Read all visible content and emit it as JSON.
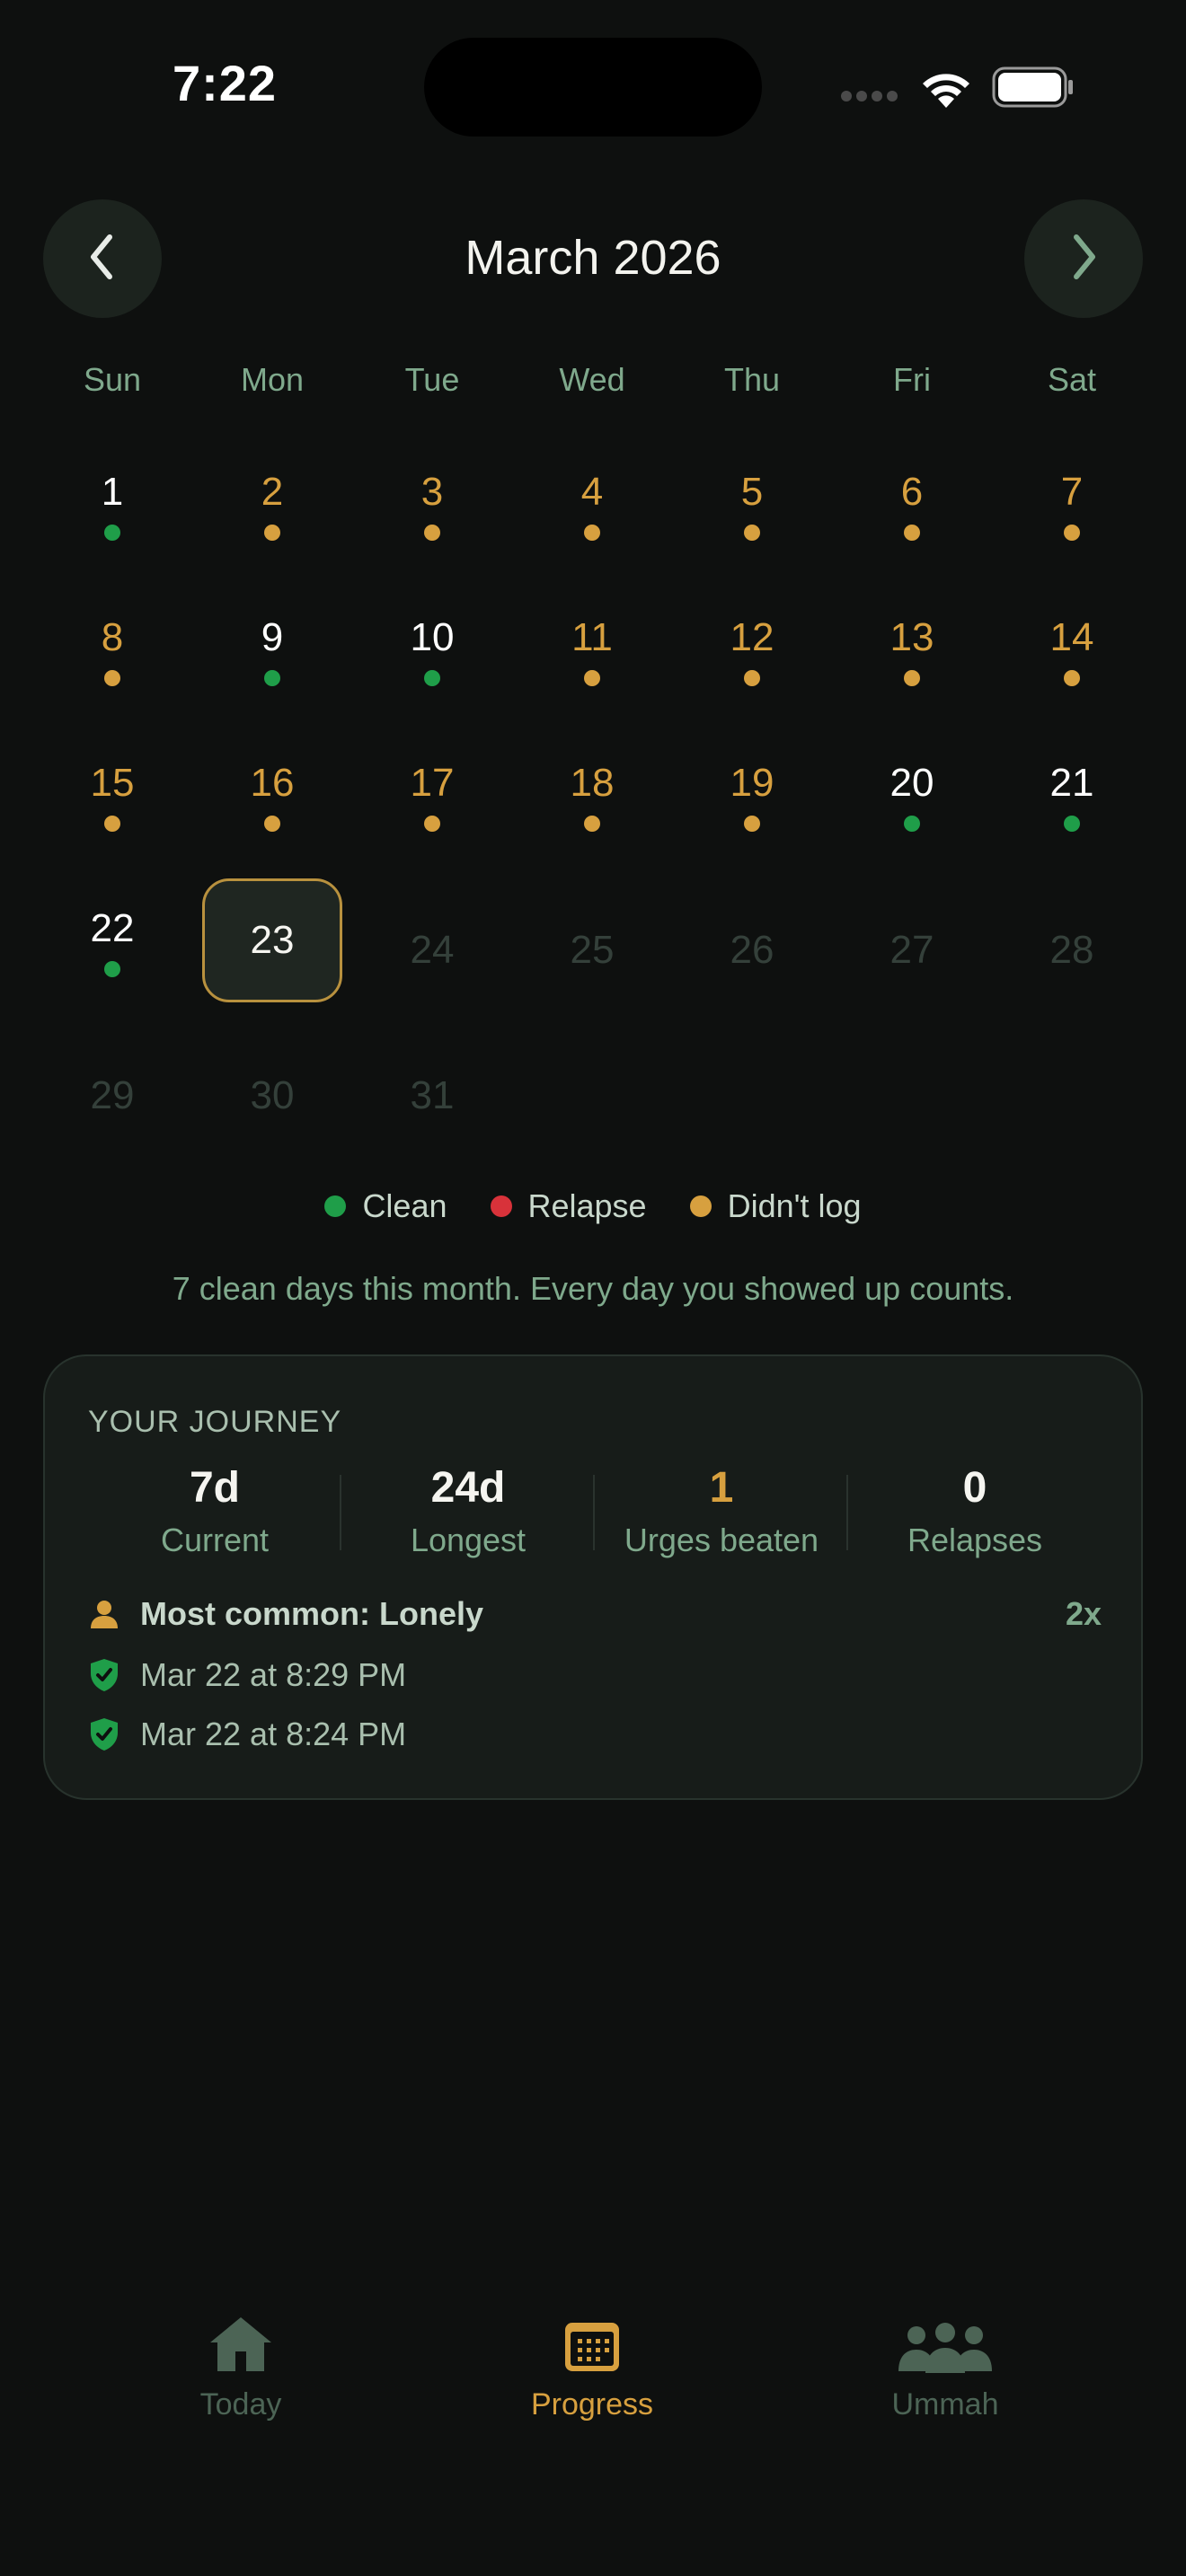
{
  "status_bar": {
    "time": "7:22"
  },
  "header": {
    "month_title": "March 2026",
    "prev_icon": "chevron-left-icon",
    "next_icon": "chevron-right-icon"
  },
  "weekdays": [
    "Sun",
    "Mon",
    "Tue",
    "Wed",
    "Thu",
    "Fri",
    "Sat"
  ],
  "calendar": {
    "days": [
      {
        "d": "1",
        "s": "clean"
      },
      {
        "d": "2",
        "s": "missed"
      },
      {
        "d": "3",
        "s": "missed"
      },
      {
        "d": "4",
        "s": "missed"
      },
      {
        "d": "5",
        "s": "missed"
      },
      {
        "d": "6",
        "s": "missed"
      },
      {
        "d": "7",
        "s": "missed"
      },
      {
        "d": "8",
        "s": "missed"
      },
      {
        "d": "9",
        "s": "clean"
      },
      {
        "d": "10",
        "s": "clean"
      },
      {
        "d": "11",
        "s": "missed"
      },
      {
        "d": "12",
        "s": "missed"
      },
      {
        "d": "13",
        "s": "missed"
      },
      {
        "d": "14",
        "s": "missed"
      },
      {
        "d": "15",
        "s": "missed"
      },
      {
        "d": "16",
        "s": "missed"
      },
      {
        "d": "17",
        "s": "missed"
      },
      {
        "d": "18",
        "s": "missed"
      },
      {
        "d": "19",
        "s": "missed"
      },
      {
        "d": "20",
        "s": "clean"
      },
      {
        "d": "21",
        "s": "clean"
      },
      {
        "d": "22",
        "s": "clean"
      },
      {
        "d": "23",
        "s": "today"
      },
      {
        "d": "24",
        "s": "future"
      },
      {
        "d": "25",
        "s": "future"
      },
      {
        "d": "26",
        "s": "future"
      },
      {
        "d": "27",
        "s": "future"
      },
      {
        "d": "28",
        "s": "future"
      },
      {
        "d": "29",
        "s": "future"
      },
      {
        "d": "30",
        "s": "future"
      },
      {
        "d": "31",
        "s": "future"
      }
    ]
  },
  "legend": [
    {
      "label": "Clean",
      "color": "#1f9e49"
    },
    {
      "label": "Relapse",
      "color": "#d8323a"
    },
    {
      "label": "Didn't log",
      "color": "#d7a03f"
    }
  ],
  "summary_text": "7 clean days this month. Every day you showed up counts.",
  "journey": {
    "title": "YOUR JOURNEY",
    "stats": [
      {
        "value": "7d",
        "label": "Current",
        "highlight": false
      },
      {
        "value": "24d",
        "label": "Longest",
        "highlight": false
      },
      {
        "value": "1",
        "label": "Urges beaten",
        "highlight": true
      },
      {
        "value": "0",
        "label": "Relapses",
        "highlight": false
      }
    ],
    "most_common": {
      "label": "Most common: Lonely",
      "count": "2x",
      "icon": "person-icon"
    },
    "entries": [
      {
        "text": "Mar 22 at 8:29 PM",
        "icon": "shield-check-icon"
      },
      {
        "text": "Mar 22 at 8:24 PM",
        "icon": "shield-check-icon"
      }
    ]
  },
  "tabs": [
    {
      "label": "Today",
      "icon": "house-icon",
      "active": false
    },
    {
      "label": "Progress",
      "icon": "calendar-icon",
      "active": true
    },
    {
      "label": "Ummah",
      "icon": "people-icon",
      "active": false
    }
  ],
  "colors": {
    "background": "#0e100f",
    "accent_gold": "#d7a03f",
    "clean_green": "#1f9e49",
    "relapse_red": "#d8323a",
    "muted_green": "#7fa98c"
  }
}
